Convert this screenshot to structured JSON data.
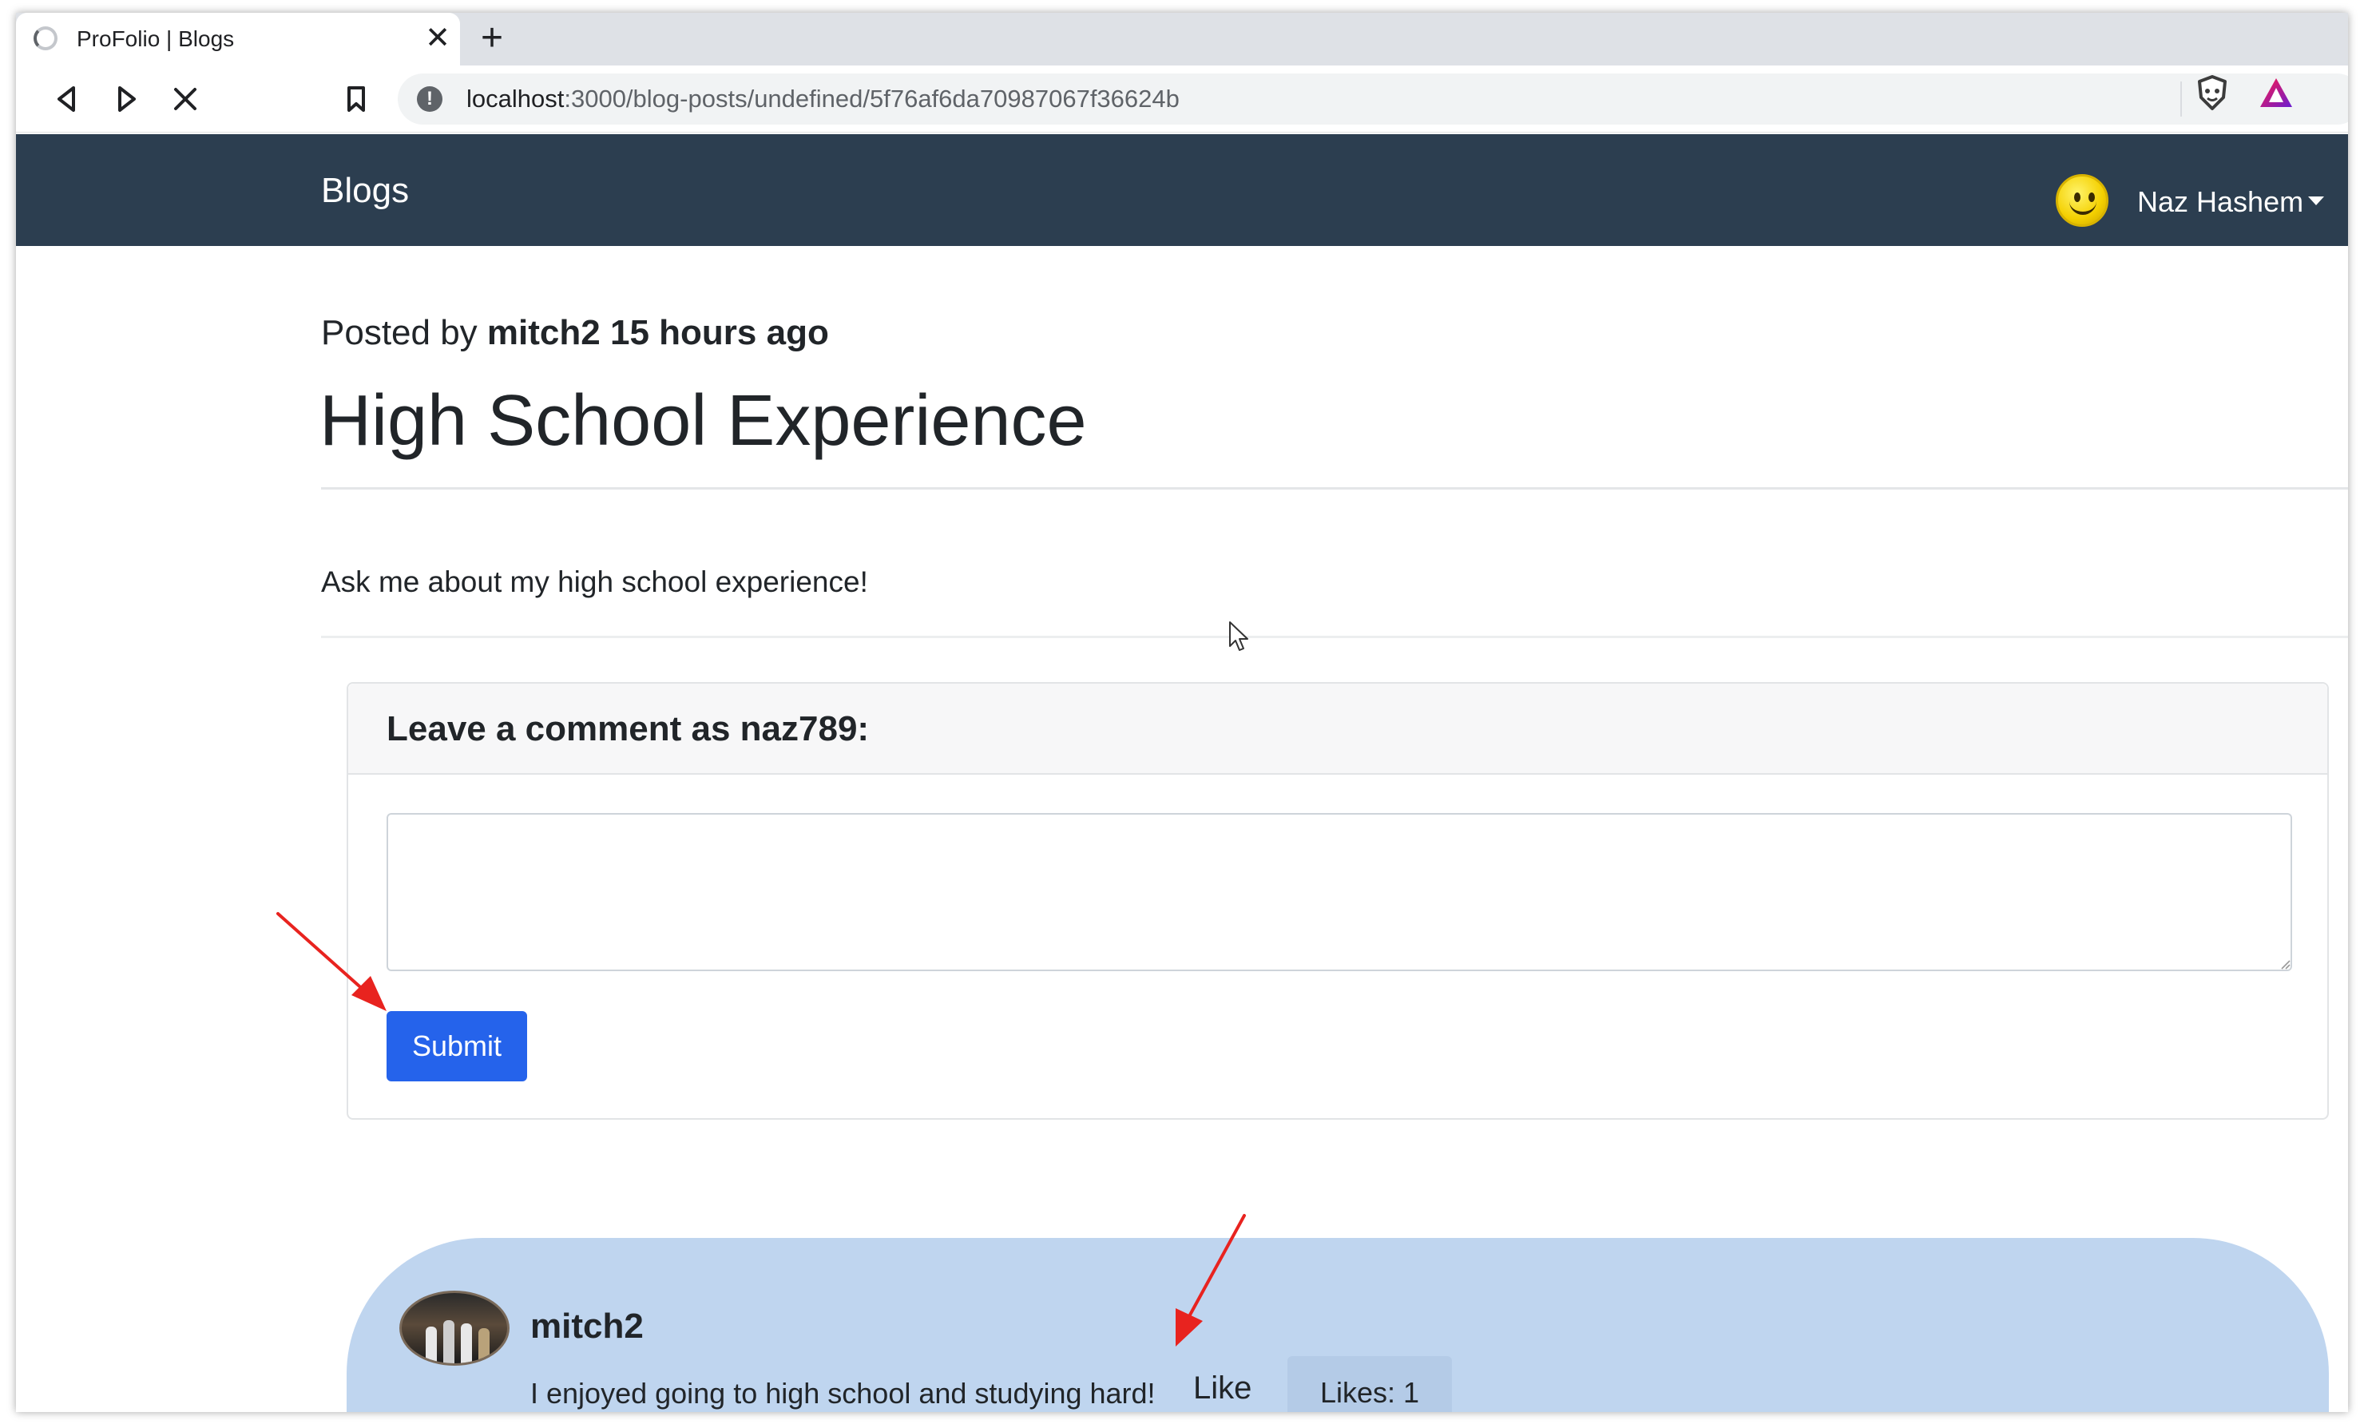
{
  "browser": {
    "tab_title": "ProFolio | Blogs",
    "close_glyph": "✕",
    "new_tab_glyph": "+",
    "url_host": "localhost",
    "url_path": ":3000/blog-posts/undefined/5f76af6da70987067f36624b",
    "info_glyph": "!"
  },
  "navbar": {
    "brand": "Blogs",
    "user_name": "Naz Hashem"
  },
  "post": {
    "posted_prefix": "Posted by",
    "author": "mitch2",
    "time_ago": "15 hours ago",
    "title": "High School Experience",
    "body": "Ask me about my high school experience!"
  },
  "comment_form": {
    "heading": "Leave a comment as naz789:",
    "textarea_value": "",
    "submit_label": "Submit"
  },
  "comments": [
    {
      "author": "mitch2",
      "text": "I enjoyed going to high school and studying hard!",
      "like_label": "Like",
      "likes_label": "Likes: 1"
    }
  ],
  "colors": {
    "navbar_bg": "#2c3e50",
    "submit_bg": "#2563eb",
    "comment_bg": "#bfd5ef",
    "annotation_arrow": "#e8231f"
  },
  "icons": [
    "loading-spinner-icon",
    "close-icon",
    "plus-icon",
    "back-icon",
    "forward-icon",
    "stop-icon",
    "bookmark-icon",
    "info-icon",
    "brave-shield-icon",
    "brave-rewards-icon",
    "smiley-avatar-icon",
    "caret-down-icon",
    "mouse-cursor-icon"
  ]
}
